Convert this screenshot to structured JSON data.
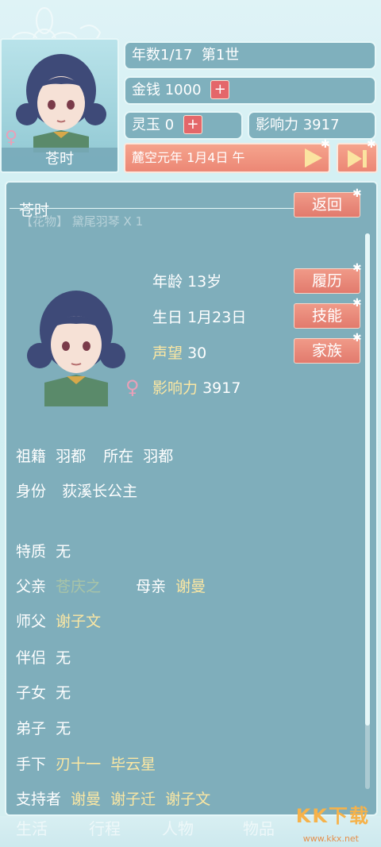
{
  "header": {
    "name": "苍时",
    "gender_symbol": "♀",
    "year_info": "年数1/17  第1世",
    "money_label": "金钱",
    "money_value": "1000",
    "jade_label": "灵玉",
    "jade_value": "0",
    "influence_label": "影响力",
    "influence_value": "3917",
    "plus": "+",
    "date": "麓空元年 1月4日 午"
  },
  "panel": {
    "title": "苍时",
    "ghost_text": "【花物】 黛尾羽琴 X 1",
    "back_button": "返回",
    "buttons": [
      "履历",
      "技能",
      "家族"
    ],
    "stats": {
      "age_label": "年龄",
      "age_value": "13岁",
      "birthday_label": "生日",
      "birthday_value": "1月23日",
      "fame_label": "声望",
      "fame_value": "30",
      "influence_label": "影响力",
      "influence_value": "3917"
    },
    "origin_label": "祖籍",
    "origin_value": "羽都",
    "location_label": "所在",
    "location_value": "羽都",
    "identity_label": "身份",
    "identity_value": "荻溪长公主",
    "trait_label": "特质",
    "trait_value": "无",
    "father_label": "父亲",
    "father_value": "苍庆之",
    "mother_label": "母亲",
    "mother_value": "谢曼",
    "master_label": "师父",
    "master_value": "谢子文",
    "partner_label": "伴侣",
    "partner_value": "无",
    "children_label": "子女",
    "children_value": "无",
    "disciple_label": "弟子",
    "disciple_value": "无",
    "subordinate_label": "手下",
    "subordinates": [
      "刃十一",
      "毕云星"
    ],
    "supporter_label": "支持者",
    "supporters": [
      "谢曼",
      "谢子迁",
      "谢子文"
    ]
  },
  "tabs": [
    "生活",
    "行程",
    "人物",
    "物品"
  ],
  "watermark": {
    "logo": "KK下载",
    "url": "www.kkx.net"
  },
  "colors": {
    "panel": "#7faebb",
    "button": "#e27a6d",
    "gold_text": "#fbe7a3",
    "grey_text": "#a8c4a8"
  }
}
